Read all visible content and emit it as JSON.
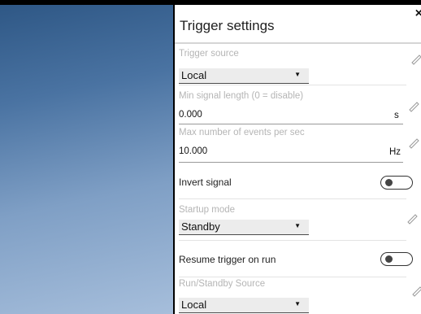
{
  "panel": {
    "title": "Trigger settings",
    "close_glyph": "×"
  },
  "fields": {
    "trigger_source": {
      "label": "Trigger source",
      "value": "Local"
    },
    "min_signal_length": {
      "label": "Min signal length (0 = disable)",
      "value": "0.000",
      "unit": "s"
    },
    "max_events": {
      "label": "Max number of events per sec",
      "value": "10.000",
      "unit": "Hz"
    },
    "invert_signal": {
      "label": "Invert signal",
      "on": false
    },
    "startup_mode": {
      "label": "Startup mode",
      "value": "Standby"
    },
    "resume_trigger": {
      "label": "Resume trigger on run",
      "on": false
    },
    "run_standby_source": {
      "label": "Run/Standby Source",
      "value": "Local"
    }
  },
  "icons": {
    "caret": "▼",
    "edit": "pencil-icon",
    "close": "close-icon"
  },
  "colors": {
    "label_gray": "#b5b5b5",
    "select_bg": "#ececec",
    "backdrop_top": "#2d5684",
    "backdrop_bottom": "#a6bedb"
  }
}
